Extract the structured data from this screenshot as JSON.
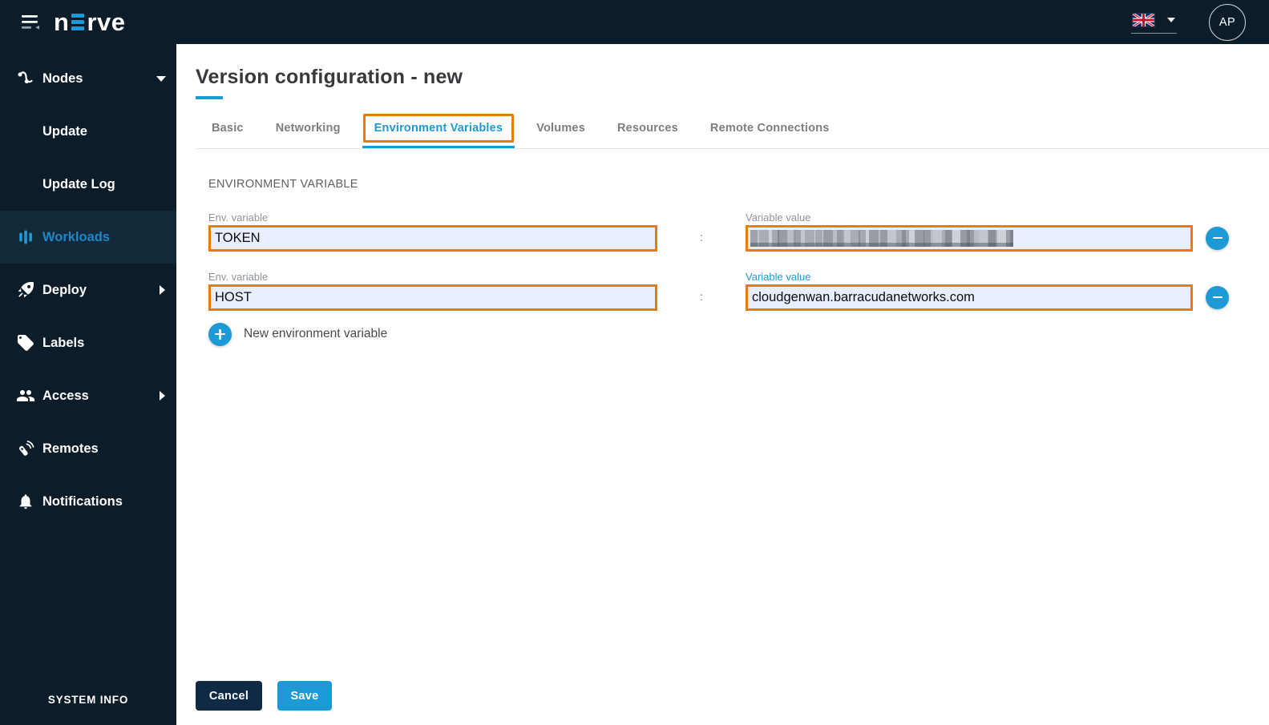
{
  "header": {
    "logo_left": "n",
    "logo_right": "rve",
    "avatar_initials": "AP"
  },
  "sidebar": {
    "items": [
      {
        "label": "Nodes"
      },
      {
        "label": "Update"
      },
      {
        "label": "Update Log"
      },
      {
        "label": "Workloads"
      },
      {
        "label": "Deploy"
      },
      {
        "label": "Labels"
      },
      {
        "label": "Access"
      },
      {
        "label": "Remotes"
      },
      {
        "label": "Notifications"
      }
    ],
    "footer_label": "SYSTEM INFO"
  },
  "main": {
    "title": "Version configuration - new",
    "tabs": [
      {
        "label": "Basic"
      },
      {
        "label": "Networking"
      },
      {
        "label": "Environment Variables"
      },
      {
        "label": "Volumes"
      },
      {
        "label": "Resources"
      },
      {
        "label": "Remote Connections"
      }
    ],
    "active_tab": "Environment Variables",
    "section_heading": "ENVIRONMENT VARIABLE",
    "separator": ":",
    "env_rows": [
      {
        "name_label": "Env. variable",
        "name_value": "TOKEN",
        "value_label": "Variable value",
        "value_value": "",
        "value_redacted": true
      },
      {
        "name_label": "Env. variable",
        "name_value": "HOST",
        "value_label": "Variable value",
        "value_value": "cloudgenwan.barracudanetworks.com",
        "value_redacted": false
      }
    ],
    "add_variable_label": "New environment variable",
    "footer": {
      "cancel_label": "Cancel",
      "save_label": "Save"
    }
  },
  "colors": {
    "accent_blue": "#1c9ad6",
    "sidebar_bg": "#0d1c29",
    "active_row_bg": "#112938",
    "annotation_orange": "#e87d0e",
    "input_bg": "#e8eefb"
  }
}
